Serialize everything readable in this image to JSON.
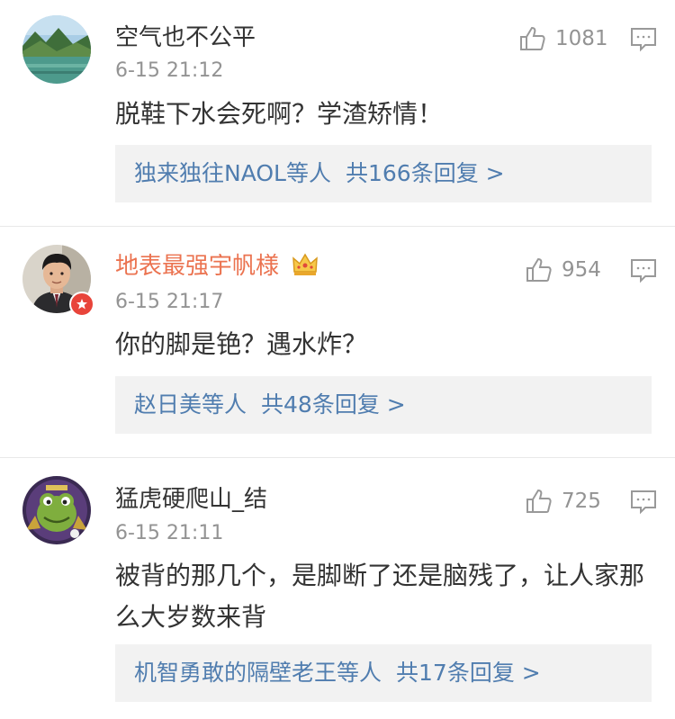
{
  "comments": [
    {
      "username": "空气也不公平",
      "time": "6-15 21:12",
      "likes": "1081",
      "text": "脱鞋下水会死啊？学渣矫情！",
      "reply_users": "独来独往NAOL等人",
      "reply_count": "共166条回复",
      "reply_arrow": ">"
    },
    {
      "username": "地表最强宇帆様",
      "time": "6-15 21:17",
      "likes": "954",
      "text": "你的脚是铯？遇水炸？",
      "reply_users": "赵日美等人",
      "reply_count": "共48条回复",
      "reply_arrow": ">"
    },
    {
      "username": "猛虎硬爬山_结",
      "time": "6-15 21:11",
      "likes": "725",
      "text": "被背的那几个，是脚断了还是脑残了，让人家那么大岁数来背",
      "reply_users": "机智勇敢的隔壁老王等人",
      "reply_count": "共17条回复",
      "reply_arrow": ">"
    }
  ],
  "colors": {
    "link": "#507daf",
    "vip_name": "#eb7350",
    "meta": "#939393",
    "reply_bg": "#f2f2f2",
    "badge": "#e8443a"
  }
}
